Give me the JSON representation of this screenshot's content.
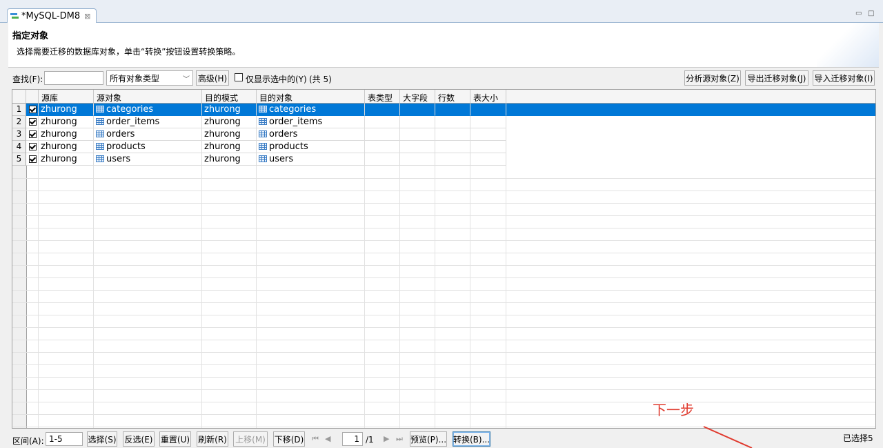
{
  "tab": {
    "title": "*MySQL-DM8",
    "close_glyph": "⊠"
  },
  "window_controls": {
    "minimize": "▭",
    "maximize": "□"
  },
  "header": {
    "title": "指定对象",
    "description": "选择需要迁移的数据库对象，单击“转换”按钮设置转换策略。"
  },
  "toolbar": {
    "find_label": "查找(F):",
    "find_value": "",
    "type_select": "所有对象类型",
    "advanced_button": "高级(H)",
    "only_selected_label": "仅显示选中的(Y)",
    "total": "(共 5)",
    "analyze_button": "分析源对象(Z)",
    "export_button": "导出迁移对象(J)",
    "import_button": "导入迁移对象(I)"
  },
  "table": {
    "columns": [
      "源库",
      "源对象",
      "目的模式",
      "目的对象",
      "表类型",
      "大字段",
      "行数",
      "表大小"
    ],
    "rows": [
      {
        "no": "1",
        "checked": true,
        "src_db": "zhurong",
        "src_obj": "categories",
        "dst_schema": "zhurong",
        "dst_obj": "categories"
      },
      {
        "no": "2",
        "checked": true,
        "src_db": "zhurong",
        "src_obj": "order_items",
        "dst_schema": "zhurong",
        "dst_obj": "order_items"
      },
      {
        "no": "3",
        "checked": true,
        "src_db": "zhurong",
        "src_obj": "orders",
        "dst_schema": "zhurong",
        "dst_obj": "orders"
      },
      {
        "no": "4",
        "checked": true,
        "src_db": "zhurong",
        "src_obj": "products",
        "dst_schema": "zhurong",
        "dst_obj": "products"
      },
      {
        "no": "5",
        "checked": true,
        "src_db": "zhurong",
        "src_obj": "users",
        "dst_schema": "zhurong",
        "dst_obj": "users"
      }
    ],
    "selected_row": 1
  },
  "bottom": {
    "range_label": "区间(A):",
    "range_value": "1-5",
    "select_button": "选择(S)",
    "invert_button": "反选(E)",
    "reset_button": "重置(U)",
    "refresh_button": "刷新(R)",
    "move_up_button": "上移(M)",
    "move_down_button": "下移(D)",
    "page_value": "1",
    "page_total": "/1",
    "preview_button": "预览(P)...",
    "convert_button": "转换(B)...",
    "selected_status": "已选择5"
  },
  "annotation": {
    "text": "下一步",
    "color": "#e03a2e"
  }
}
